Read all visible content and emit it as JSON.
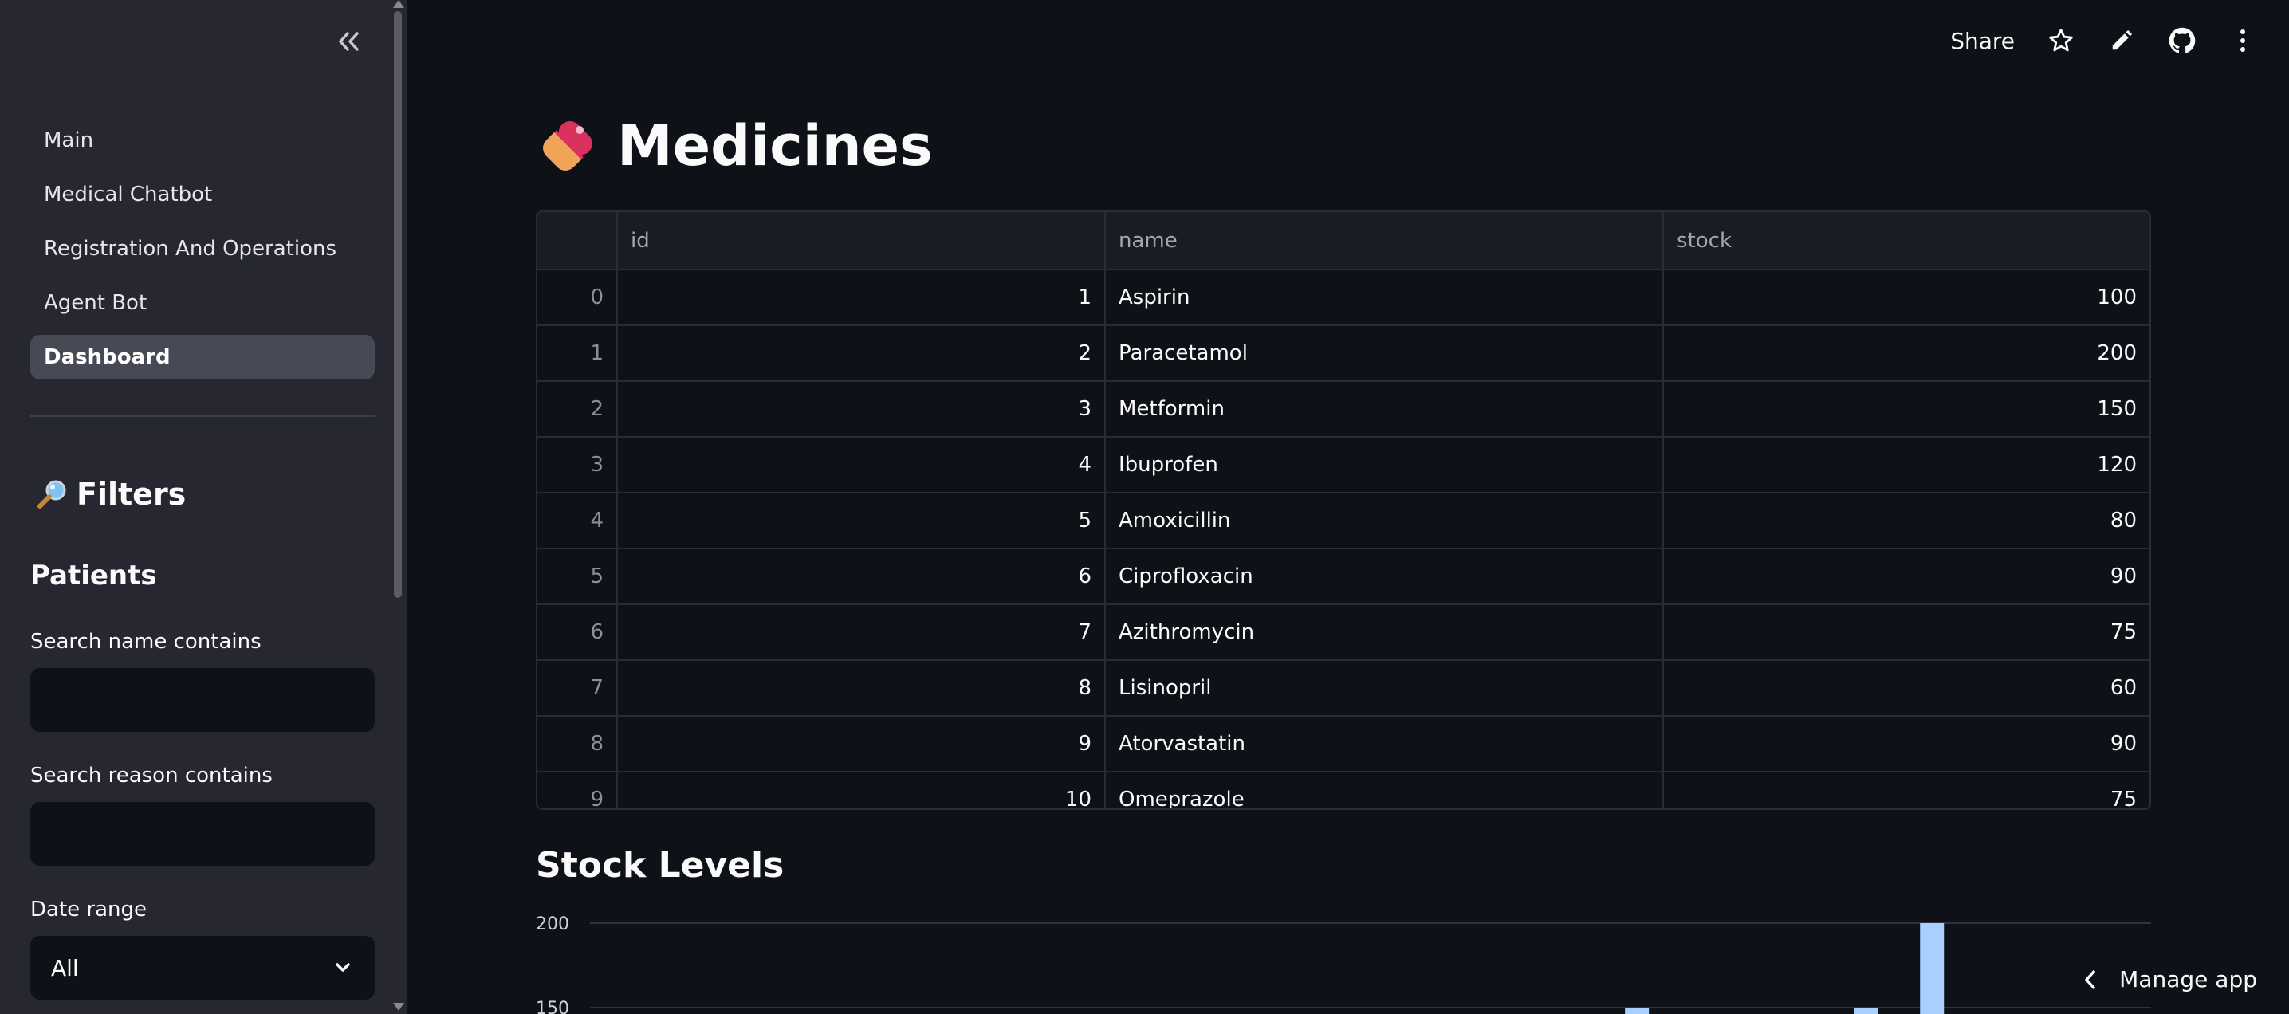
{
  "sidebar": {
    "nav": [
      "Main",
      "Medical Chatbot",
      "Registration And Operations",
      "Agent Bot",
      "Dashboard"
    ],
    "active_index": 4,
    "filters_title": "Filters",
    "filters_icon": "magnifier-emoji-icon",
    "section_title": "Patients",
    "search_name_label": "Search name contains",
    "search_name_value": "",
    "search_reason_label": "Search reason contains",
    "search_reason_value": "",
    "date_range_label": "Date range",
    "date_range_value": "All"
  },
  "header": {
    "share_label": "Share",
    "icons": [
      "star-icon",
      "pencil-icon",
      "github-icon",
      "more-vertical-icon"
    ]
  },
  "page": {
    "title": "Medicines",
    "title_icon": "pill-emoji-icon"
  },
  "table": {
    "columns": [
      "",
      "id",
      "name",
      "stock"
    ],
    "rows": [
      {
        "index": "0",
        "id": "1",
        "name": "Aspirin",
        "stock": "100"
      },
      {
        "index": "1",
        "id": "2",
        "name": "Paracetamol",
        "stock": "200"
      },
      {
        "index": "2",
        "id": "3",
        "name": "Metformin",
        "stock": "150"
      },
      {
        "index": "3",
        "id": "4",
        "name": "Ibuprofen",
        "stock": "120"
      },
      {
        "index": "4",
        "id": "5",
        "name": "Amoxicillin",
        "stock": "80"
      },
      {
        "index": "5",
        "id": "6",
        "name": "Ciprofloxacin",
        "stock": "90"
      },
      {
        "index": "6",
        "id": "7",
        "name": "Azithromycin",
        "stock": "75"
      },
      {
        "index": "7",
        "id": "8",
        "name": "Lisinopril",
        "stock": "60"
      },
      {
        "index": "8",
        "id": "9",
        "name": "Atorvastatin",
        "stock": "90"
      },
      {
        "index": "9",
        "id": "10",
        "name": "Omeprazole",
        "stock": "75"
      }
    ]
  },
  "chart_section": {
    "title": "Stock Levels"
  },
  "chart_data": {
    "type": "bar",
    "title": "",
    "xlabel": "",
    "ylabel": "",
    "ylim_visible": [
      150,
      200
    ],
    "yticks": [
      200,
      150
    ],
    "bar_color": "#a8d0ff",
    "values_visible": [
      {
        "slot": 0.663,
        "value": 150
      },
      {
        "slot": 0.81,
        "value": 150
      },
      {
        "slot": 0.852,
        "value": 200
      }
    ]
  },
  "footer": {
    "manage_label": "Manage app"
  },
  "colors": {
    "background": "#0e1117",
    "sidebar": "#262730",
    "active_nav": "#474954",
    "bar": "#a8d0ff"
  }
}
